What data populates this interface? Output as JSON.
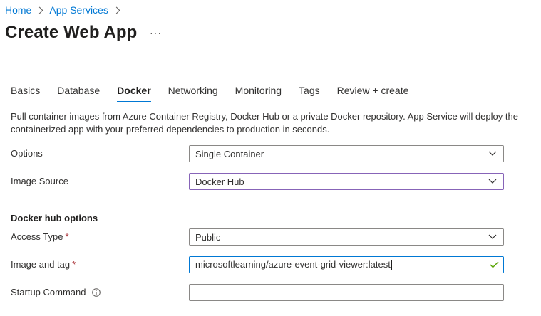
{
  "breadcrumb": {
    "items": [
      "Home",
      "App Services"
    ]
  },
  "page": {
    "title": "Create Web App",
    "more_label": "···"
  },
  "tabs": [
    {
      "label": "Basics",
      "active": false
    },
    {
      "label": "Database",
      "active": false
    },
    {
      "label": "Docker",
      "active": true
    },
    {
      "label": "Networking",
      "active": false
    },
    {
      "label": "Monitoring",
      "active": false
    },
    {
      "label": "Tags",
      "active": false
    },
    {
      "label": "Review + create",
      "active": false
    }
  ],
  "description": "Pull container images from Azure Container Registry, Docker Hub or a private Docker repository. App Service will deploy the containerized app with your preferred dependencies to production in seconds.",
  "form": {
    "options": {
      "label": "Options",
      "value": "Single Container"
    },
    "image_source": {
      "label": "Image Source",
      "value": "Docker Hub"
    },
    "section_heading": "Docker hub options",
    "access_type": {
      "label": "Access Type",
      "required_mark": "*",
      "value": "Public"
    },
    "image_and_tag": {
      "label": "Image and tag",
      "required_mark": "*",
      "value": "microsoftlearning/azure-event-grid-viewer:latest"
    },
    "startup_command": {
      "label": "Startup Command",
      "value": ""
    }
  },
  "icons": {
    "breadcrumb_separator": "chevron-right-icon",
    "dropdown": "chevron-down-icon",
    "valid": "checkmark-icon",
    "info": "info-icon"
  },
  "colors": {
    "link": "#0078d4",
    "active_tab_underline": "#0078d4",
    "required": "#a4262c",
    "valid_check": "#57a300",
    "focus_border": "#8764b8"
  }
}
